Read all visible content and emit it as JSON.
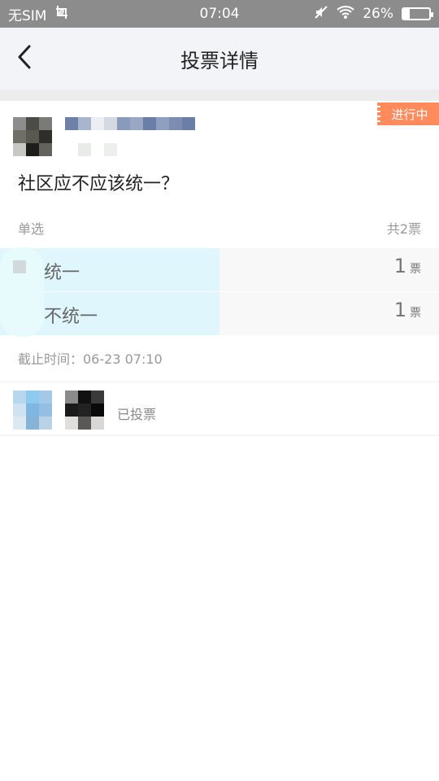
{
  "status_bar": {
    "carrier": "无SIM",
    "time": "07:04",
    "battery_percent": "26%",
    "battery_level": 0.26,
    "icons": [
      "screenshot-icon",
      "mute-icon",
      "wifi-icon",
      "battery-icon"
    ]
  },
  "header": {
    "title": "投票详情",
    "back_icon": "chevron-left-icon"
  },
  "card": {
    "badge": "进行中",
    "question": "社区应不应该统一？",
    "type_label": "单选",
    "total_votes": "共2票",
    "options": [
      {
        "label": "统一",
        "count": "1",
        "unit": "票",
        "fraction": 0.5
      },
      {
        "label": "不统一",
        "count": "1",
        "unit": "票",
        "fraction": 0.5
      }
    ],
    "deadline": "截止时间：06-23 07:10",
    "voters_text": "已投票"
  },
  "colors": {
    "header_bg": "#f3f4f7",
    "status_bar_bg": "#8c8c8c",
    "badge_bg": "#ff8a5b",
    "progress_fill": "#dff6fc"
  }
}
